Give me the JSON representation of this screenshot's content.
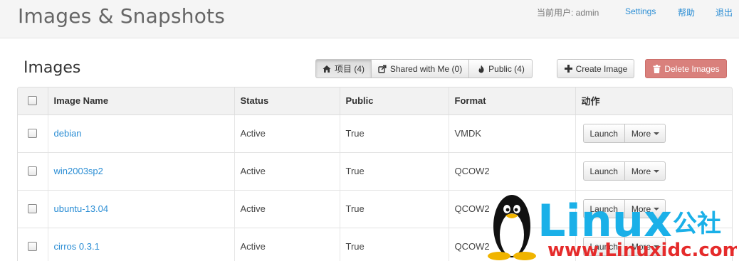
{
  "header": {
    "title": "Images & Snapshots",
    "current_user": "当前用户: admin",
    "settings": "Settings",
    "help": "帮助",
    "logout": "退出"
  },
  "section": {
    "title": "Images"
  },
  "tabs": [
    {
      "label": "项目 (4)",
      "icon": "home-icon",
      "active": true
    },
    {
      "label": "Shared with Me (0)",
      "icon": "share-icon",
      "active": false
    },
    {
      "label": "Public (4)",
      "icon": "fire-icon",
      "active": false
    }
  ],
  "toolbar": {
    "create_label": "Create Image",
    "delete_label": "Delete Images",
    "delete_color": "#d9807c"
  },
  "table": {
    "columns": [
      "Image Name",
      "Status",
      "Public",
      "Format",
      "动作"
    ],
    "rows": [
      {
        "name": "debian",
        "status": "Active",
        "public": "True",
        "format": "VMDK"
      },
      {
        "name": "win2003sp2",
        "status": "Active",
        "public": "True",
        "format": "QCOW2"
      },
      {
        "name": "ubuntu-13.04",
        "status": "Active",
        "public": "True",
        "format": "QCOW2"
      },
      {
        "name": "cirros 0.3.1",
        "status": "Active",
        "public": "True",
        "format": "QCOW2"
      }
    ],
    "launch_label": "Launch",
    "more_label": "More"
  },
  "watermark": {
    "brand": "Linux",
    "suffix": "公社",
    "url": "www.Linuxidc.com",
    "colors": {
      "brand": "#1ab0e8",
      "url": "#e52b2b"
    }
  }
}
